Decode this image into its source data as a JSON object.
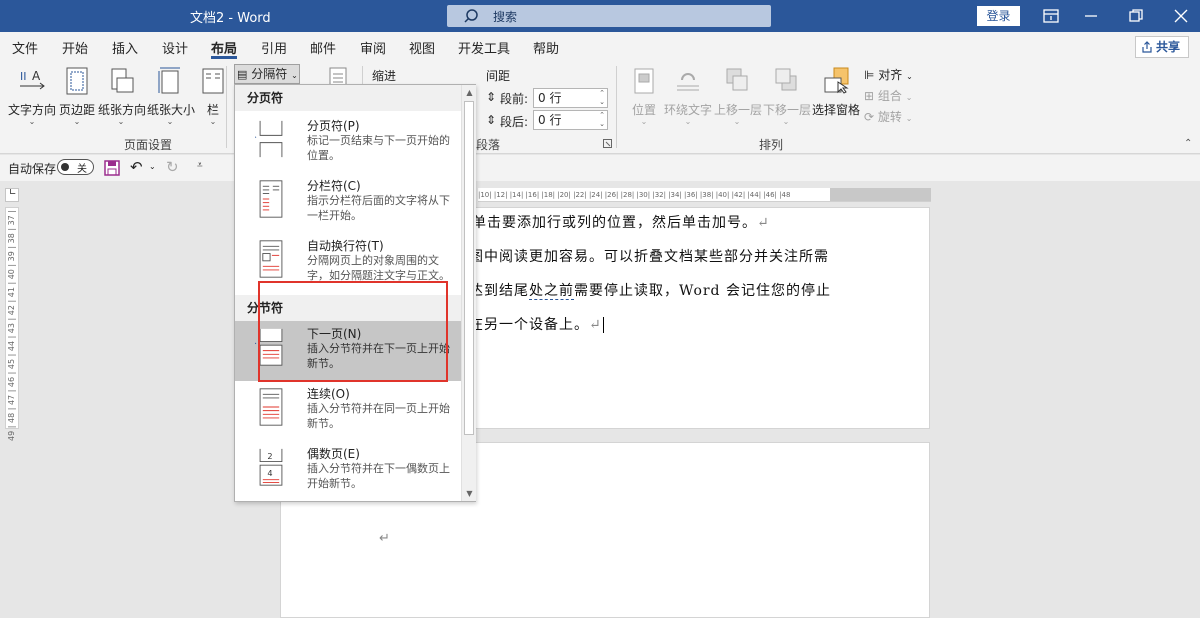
{
  "titlebar": {
    "doc_title": "文档2  -  Word",
    "search_placeholder": "搜索",
    "login_label": "登录",
    "icons": [
      "search-icon",
      "ribbon-display-icon",
      "restore-icon",
      "close-icon"
    ]
  },
  "tabs": [
    {
      "label": "文件"
    },
    {
      "label": "开始"
    },
    {
      "label": "插入"
    },
    {
      "label": "设计"
    },
    {
      "label": "布局"
    },
    {
      "label": "引用"
    },
    {
      "label": "邮件"
    },
    {
      "label": "审阅"
    },
    {
      "label": "视图"
    },
    {
      "label": "开发工具"
    },
    {
      "label": "帮助"
    }
  ],
  "active_tab": "布局",
  "share_label": "共享",
  "ribbon": {
    "page_setup": {
      "text_direction": "文字方向",
      "margins": "页边距",
      "orientation": "纸张方向",
      "size": "纸张大小",
      "columns": "栏",
      "breaks": "分隔符",
      "group_label": "页面设置"
    },
    "indent_label": "缩进",
    "spacing": {
      "label": "间距",
      "before_label": "段前:",
      "before_value": "0 行",
      "after_label": "段后:",
      "after_value": "0 行",
      "group_label": "段落"
    },
    "arrange": {
      "position": "位置",
      "wrap_text": "环绕文字",
      "bring_forward": "上移一层",
      "send_backward": "下移一层",
      "selection_pane": "选择窗格",
      "align": "对齐",
      "group": "组合",
      "rotate": "旋转",
      "group_label": "排列"
    }
  },
  "qat": {
    "autosave_label": "自动保存",
    "autosave_state": "关"
  },
  "ruler": {
    "horizontal": "|10|  |12|  |14|  |16|  |18|  |20|  |22|  |24|  |26|  |28|  |30|  |32|  |34|  |36|  |38|    |40|  |42|  |44|  |46|  |48",
    "vertical": "49 | 48 | 47 | 46 | 45 | 44 | 43 | 42 | 41 | 40 | 39 | 38 | 37 |"
  },
  "document": {
    "lines": [
      "，单击要添加行或列的位置，然后单击加号。",
      "图中阅读更加容易。可以折叠文档某些部分并关注所需",
      "达到结尾处之前需要停止读取，Word 会记住您的停止",
      "在另一个设备上。"
    ],
    "line3_underlined": "处之前",
    "paragraph_mark": "↵"
  },
  "dropdown": {
    "page_breaks_header": "分页符",
    "section_breaks_header": "分节符",
    "items": [
      {
        "title": "分页符(P)",
        "desc": "标记一页结束与下一页开始的位置。"
      },
      {
        "title": "分栏符(C)",
        "desc": "指示分栏符后面的文字将从下一栏开始。"
      },
      {
        "title": "自动换行符(T)",
        "desc": "分隔网页上的对象周围的文字，如分隔题注文字与正文。"
      },
      {
        "title": "下一页(N)",
        "desc": "插入分节符并在下一页上开始新节。"
      },
      {
        "title": "连续(O)",
        "desc": "插入分节符并在同一页上开始新节。"
      },
      {
        "title": "偶数页(E)",
        "desc": "插入分节符并在下一偶数页上开始新节。"
      }
    ],
    "highlighted_item": "下一页(N)"
  },
  "colors": {
    "title_bar": "#2b579a",
    "ribbon_bg": "#f3f3f3",
    "highlight": "#c6c6c6",
    "annotation_red": "#e0342b"
  }
}
